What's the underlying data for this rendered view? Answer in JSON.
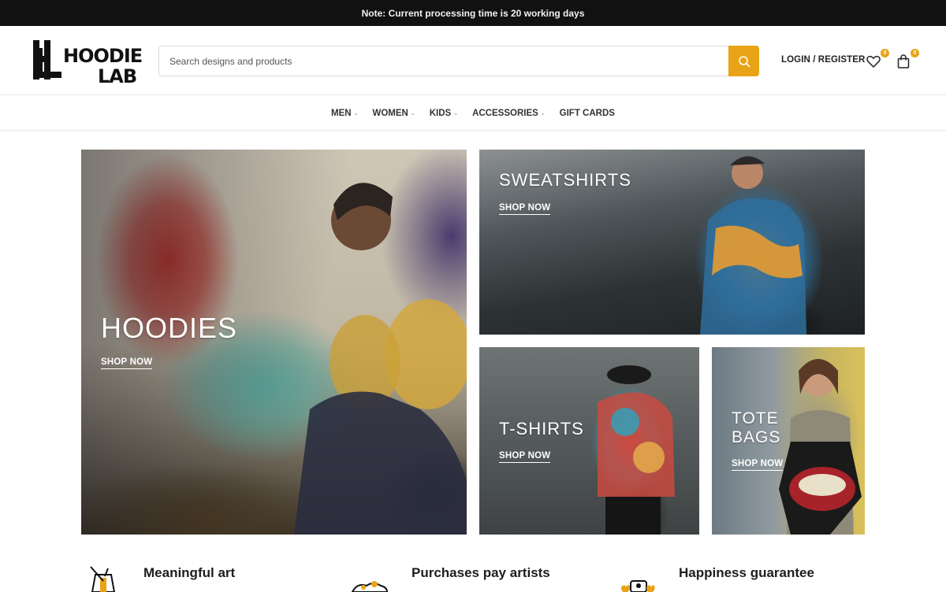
{
  "announcement": "Note: Current processing time is 20 working days",
  "brand": {
    "logo_text_top": "HOODIE",
    "logo_text_bottom": "LAB",
    "accent": "#e8a317"
  },
  "search": {
    "placeholder": "Search designs and products"
  },
  "header": {
    "login_label": "LOGIN / REGISTER",
    "wishlist_count": "0",
    "cart_count": "0"
  },
  "nav": {
    "items": [
      {
        "label": "MEN",
        "dropdown": true
      },
      {
        "label": "WOMEN",
        "dropdown": true
      },
      {
        "label": "KIDS",
        "dropdown": true
      },
      {
        "label": "ACCESSORIES",
        "dropdown": true
      },
      {
        "label": "GIFT CARDS",
        "dropdown": false
      }
    ]
  },
  "tiles": {
    "hoodies": {
      "title": "HOODIES",
      "cta": "SHOP NOW"
    },
    "sweatshirts": {
      "title": "SWEATSHIRTS",
      "cta": "SHOP NOW"
    },
    "tshirts": {
      "title": "T-SHIRTS",
      "cta": "SHOP NOW"
    },
    "tote_bags": {
      "title_line1": "TOTE",
      "title_line2": "BAGS",
      "cta": "SHOP NOW"
    }
  },
  "features": [
    {
      "label": "Meaningful art",
      "icon": "paint-bucket-icon"
    },
    {
      "label": "Purchases pay artists",
      "icon": "artist-tools-icon"
    },
    {
      "label": "Happiness guarantee",
      "icon": "happiness-icon"
    }
  ]
}
